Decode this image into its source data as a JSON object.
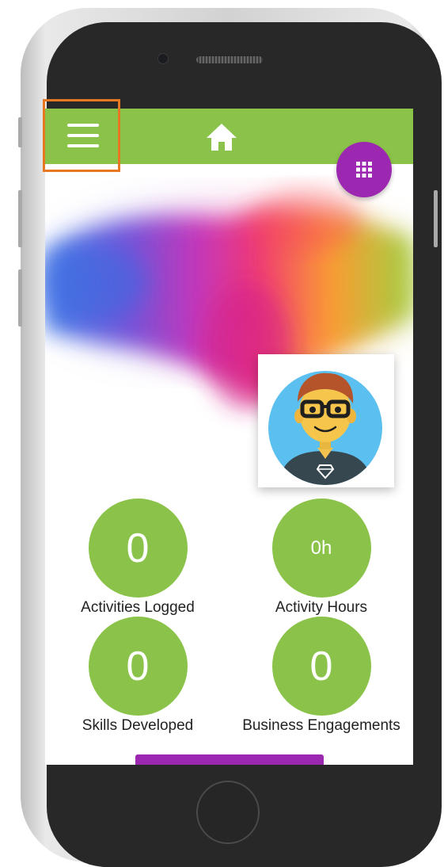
{
  "stats": [
    {
      "value": "0",
      "label": "Activities Logged"
    },
    {
      "value": "0h",
      "label": "Activity Hours"
    },
    {
      "value": "0",
      "label": "Skills Developed"
    },
    {
      "value": "0",
      "label": "Business Engagements"
    }
  ],
  "icons": {
    "menu": "menu-icon",
    "home": "home-icon",
    "apps": "grid-icon",
    "avatar": "avatar-icon"
  },
  "colors": {
    "brand_green": "#8bc34a",
    "accent_purple": "#9c27b0",
    "highlight_orange": "#e87722"
  }
}
